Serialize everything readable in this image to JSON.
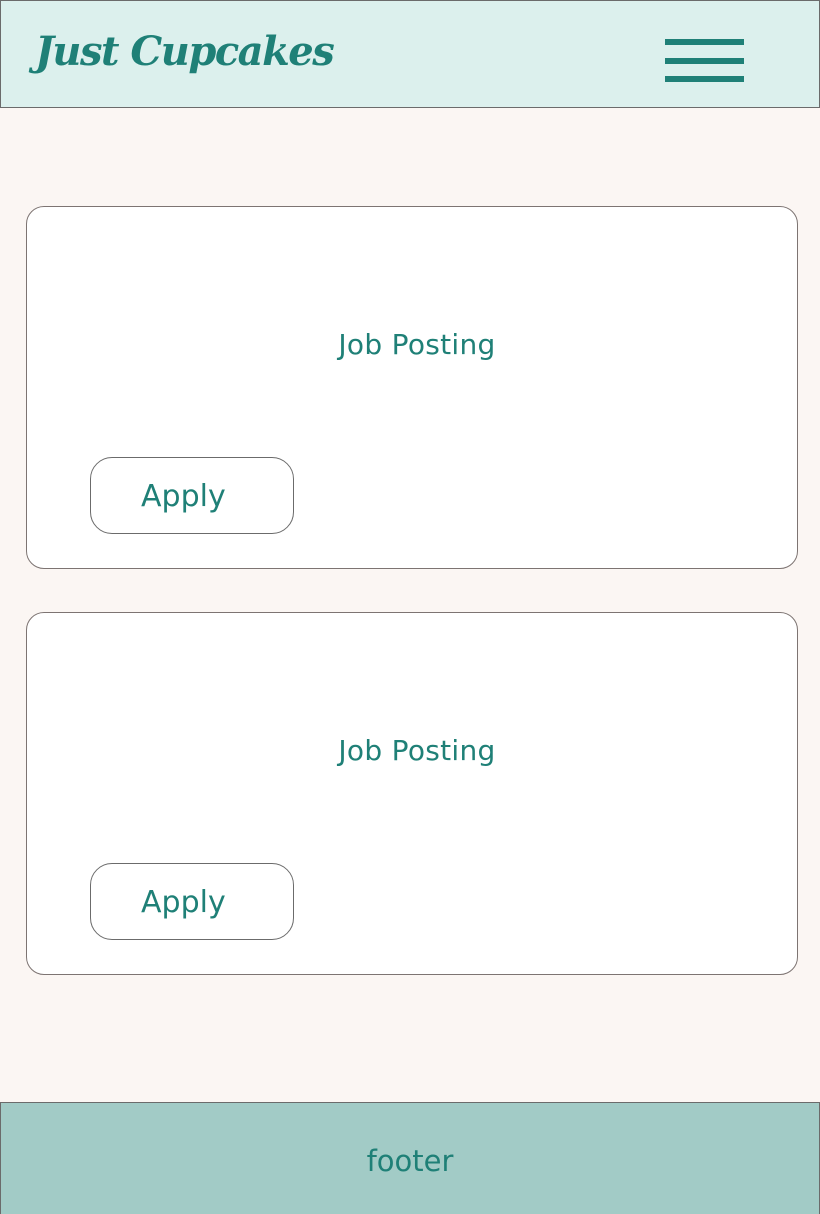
{
  "header": {
    "logo_text": "Just Cupcakes",
    "menu_icon": "hamburger-menu-icon"
  },
  "jobs": [
    {
      "title": "Job Posting",
      "apply_label": "Apply"
    },
    {
      "title": "Job Posting",
      "apply_label": "Apply"
    }
  ],
  "footer": {
    "text": "footer"
  },
  "colors": {
    "accent": "#1f8077",
    "header_bg": "#dcf0ed",
    "page_bg": "#fbf6f3",
    "footer_bg": "#a2cbc6"
  }
}
